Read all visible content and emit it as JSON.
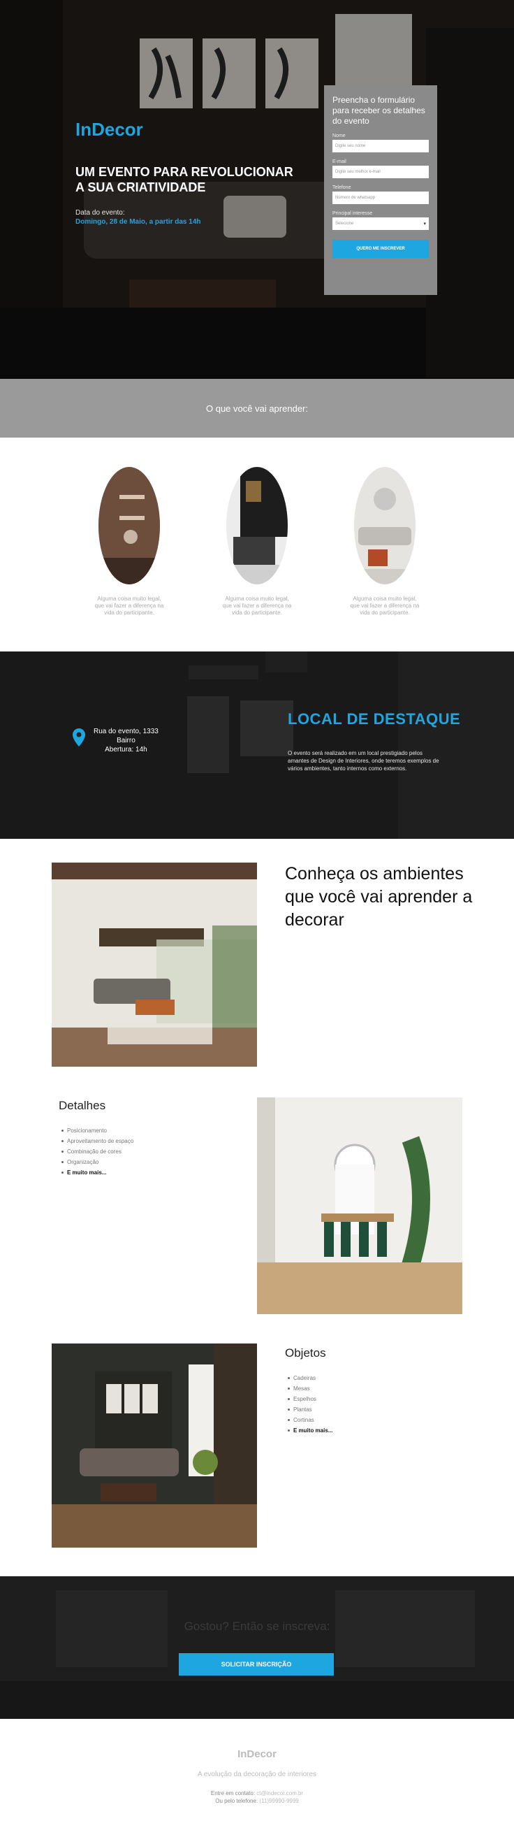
{
  "hero": {
    "logo": "InDecor",
    "title": "UM EVENTO PARA REVOLUCIONAR A SUA CRIATIVIDADE",
    "date_label": "Data do evento:",
    "date_value": "Domingo, 28 de Maio, a partir das 14h"
  },
  "form": {
    "title": "Preencha o formulário para receber os detalhes do evento",
    "fields": [
      {
        "label": "Nome",
        "placeholder": "Digite seu nome"
      },
      {
        "label": "E-mail",
        "placeholder": "Digite seu melhor e-mail"
      },
      {
        "label": "Telefone",
        "placeholder": "Número de whatsapp"
      }
    ],
    "select_label": "Principal interesse",
    "select_value": "Selecione",
    "submit_label": "QUERO ME INSCREVER"
  },
  "learn": {
    "title": "O que você vai aprender:",
    "cards": [
      {
        "text": "Alguma coisa muito legal, que vai fazer a diferença na vida do participante."
      },
      {
        "text": "Alguma coisa muito legal, que vai fazer a diferença na vida do participante."
      },
      {
        "text": "Alguma coisa muito legal, que vai fazer a diferença na vida do participante."
      }
    ]
  },
  "location": {
    "address_line1": "Rua do evento, 1333",
    "address_line2": "Bairro",
    "address_line3": "Abertura: 14h",
    "title": "LOCAL DE DESTAQUE",
    "text": "O evento será realizado em um local prestigiado pelos amantes de Design de Interiores, onde teremos exemplos de vários ambientes, tanto internos como externos."
  },
  "ambientes": {
    "title": "Conheça os ambientes que você vai aprender a decorar",
    "detalhes": {
      "title": "Detalhes",
      "items": [
        "Posicionamento",
        "Aproveitamento de espaço",
        "Combinação de cores",
        "Organização"
      ],
      "more": "E muito mais..."
    },
    "objetos": {
      "title": "Objetos",
      "items": [
        "Cadeiras",
        "Mesas",
        "Espelhos",
        "Plantas",
        "Cortinas"
      ],
      "more": "E muito mais..."
    }
  },
  "cta": {
    "text": "Gostou? Então se inscreva:",
    "button": "SOLICITAR INSCRIÇÃO"
  },
  "footer": {
    "logo": "InDecor",
    "tagline": "A evolução da decoração de interiores",
    "contact_label": "Entre em contato:",
    "contact_email": "ct@indecor.com.br",
    "phone_label": "Ou pelo telefone:",
    "phone": "(11)99990-9999"
  },
  "colors": {
    "accent": "#1ea6e0",
    "form_bg": "#8a8a8a",
    "band_bg": "#9a9a9a"
  }
}
